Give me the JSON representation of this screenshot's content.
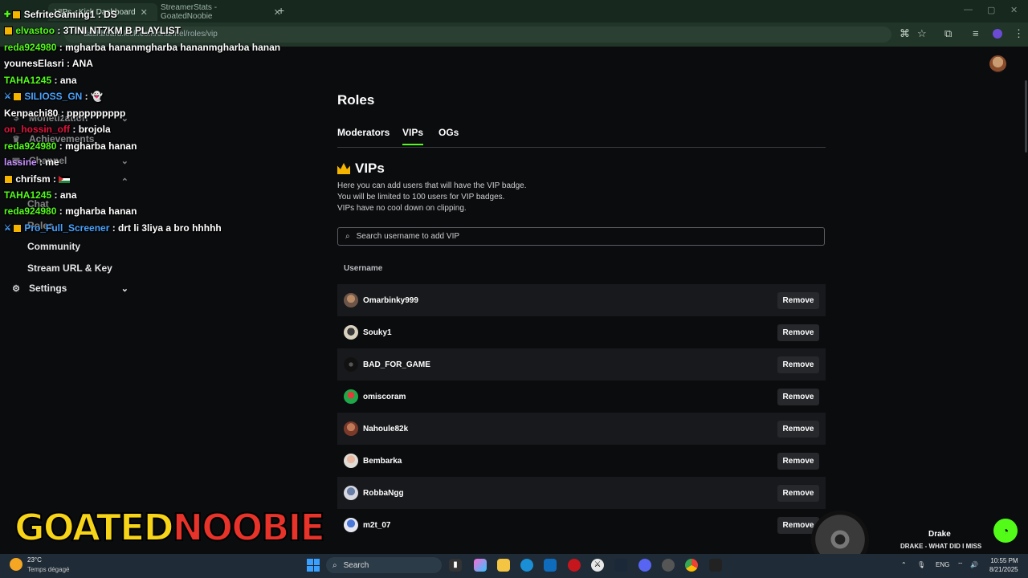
{
  "browser": {
    "tabs": [
      {
        "label": "VIPs - Kick Dashboard"
      },
      {
        "label": "StreamerStats - GoatedNoobie"
      }
    ],
    "url": "dashboard.kick.com/channel/roles/vip",
    "new_tab_glyph": "+",
    "window_controls": [
      "—",
      "▢",
      "✕"
    ]
  },
  "sidebar": {
    "items": [
      {
        "label": "Monetization",
        "icon": "dollar-icon"
      },
      {
        "label": "Achievements",
        "icon": "trophy-icon"
      },
      {
        "label": "Channel",
        "icon": "channel-icon"
      },
      {
        "label": "Chat"
      },
      {
        "label": "Roles"
      },
      {
        "label": "Community"
      },
      {
        "label": "Stream URL & Key"
      },
      {
        "label": "Settings",
        "icon": "gear-icon"
      }
    ]
  },
  "main": {
    "heading": "Roles",
    "tabs": [
      {
        "label": "Moderators",
        "active": false
      },
      {
        "label": "VIPs",
        "active": true
      },
      {
        "label": "OGs",
        "active": false
      }
    ],
    "section_title": "VIPs",
    "description": [
      "Here you can add users that will have the VIP badge.",
      "You will be limited to 100 users for VIP badges.",
      "VIPs have no cool down on clipping."
    ],
    "search_placeholder": "Search username to add VIP",
    "column_header": "Username",
    "remove_label": "Remove",
    "vips": [
      {
        "username": "Omarbinky999"
      },
      {
        "username": "Souky1"
      },
      {
        "username": "BAD_FOR_GAME"
      },
      {
        "username": "omiscoram"
      },
      {
        "username": "Nahoule82k"
      },
      {
        "username": "Bembarka"
      },
      {
        "username": "RobbaNgg"
      },
      {
        "username": "m2t_07"
      }
    ]
  },
  "chat": {
    "messages": [
      {
        "user": "SefriteGaming1",
        "text": "DS",
        "color": "#ffffff"
      },
      {
        "user": "elvastoo",
        "text": "3TINI NT7KM B PLAYLIST",
        "color": "#53fc18"
      },
      {
        "user": "reda924980",
        "text": "mgharba hananmgharba hananmgharba hanan",
        "color": "#53fc18"
      },
      {
        "user": "younesElasri",
        "text": "ANA",
        "color": "#ffffff"
      },
      {
        "user": "TAHA1245",
        "text": "ana",
        "color": "#53fc18"
      },
      {
        "user": "SILIOSS_GN",
        "text": "👻",
        "color": "#4aa3ff"
      },
      {
        "user": "Kenpachi80",
        "text": "pppppppppp",
        "color": "#ffffff"
      },
      {
        "user": "on_hossin_off",
        "text": "brojola",
        "color": "#e0143c"
      },
      {
        "user": "reda924980",
        "text": "mgharba hanan",
        "color": "#53fc18"
      },
      {
        "user": "lassine",
        "text": "me",
        "color": "#c890ff"
      },
      {
        "user": "chrifsm",
        "text": "",
        "color": "#ffffff"
      },
      {
        "user": "TAHA1245",
        "text": "ana",
        "color": "#53fc18"
      },
      {
        "user": "reda924980",
        "text": "mgharba hanan",
        "color": "#53fc18"
      },
      {
        "user": "Pro_Full_Screener",
        "text": "drt li 3liya a bro hhhhh",
        "color": "#4aa3ff"
      }
    ]
  },
  "overlay": {
    "logo_part1": "GOATED",
    "logo_part2": "NOOBIE",
    "now_playing_artist": "Drake",
    "now_playing_track": "DRAKE - WHAT DID I MISS"
  },
  "taskbar": {
    "temperature": "23°C",
    "condition": "Temps dégagé",
    "search_label": "Search",
    "language": "ENG",
    "time": "10:55 PM",
    "date": "8/21/2025"
  },
  "colors": {
    "accent": "#53fc18",
    "vip_crown": "#f5b400",
    "background": "#0b0c0e",
    "row_alt": "#18191c"
  }
}
